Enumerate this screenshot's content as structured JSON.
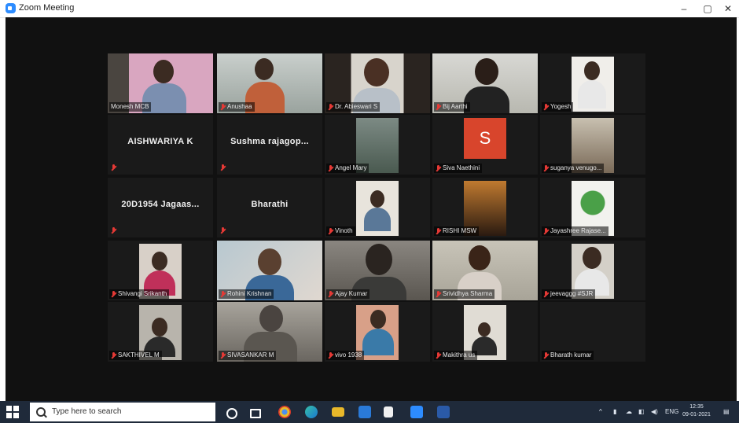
{
  "window": {
    "title": "Zoom Meeting",
    "minimize": "–",
    "restore": "▢",
    "close": "✕"
  },
  "participants": [
    {
      "name": "Monesh MCB"
    },
    {
      "name": "Anushaa"
    },
    {
      "name": "Dr. Abieswari S"
    },
    {
      "name": "Bij Aarthi"
    },
    {
      "name": "Yogesh"
    },
    {
      "name": "AISHWARIYA K"
    },
    {
      "name": "Sushma rajagop..."
    },
    {
      "name": "Angel Mary"
    },
    {
      "name": "Siva Naethini",
      "initial": "S"
    },
    {
      "name": "suganya venugo..."
    },
    {
      "name": "20D1954 Jagaas..."
    },
    {
      "name": "Bharathi"
    },
    {
      "name": "Vinoth"
    },
    {
      "name": "RISHI MSW"
    },
    {
      "name": "Jayashree Rajase..."
    },
    {
      "name": "Shivangi Srikanth"
    },
    {
      "name": "Rohini Krishnan"
    },
    {
      "name": "Ajay Kumar"
    },
    {
      "name": "Srividhya Sharma"
    },
    {
      "name": "jeevaggg #SJR"
    },
    {
      "name": "SAKTHIVEL M"
    },
    {
      "name": "SIVASANKAR M"
    },
    {
      "name": "vivo 1938"
    },
    {
      "name": "Makithra us"
    },
    {
      "name": "Bharath kumar"
    }
  ],
  "taskbar": {
    "search_placeholder": "Type here to search",
    "language": "ENG",
    "time": "12:35",
    "date": "09-01-2021"
  },
  "colors": {
    "active_speaker": "#c8d400",
    "muted_mic": "#e53935",
    "avatar_s": "#d8452c",
    "taskbar": "#1f2a3a"
  }
}
